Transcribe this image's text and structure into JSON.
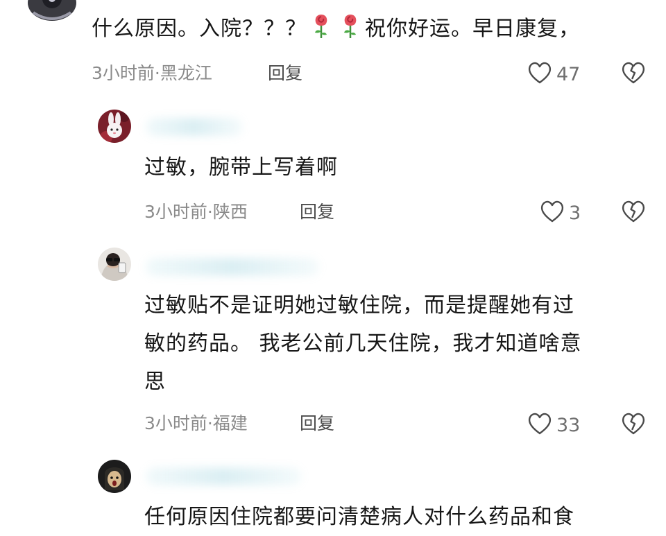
{
  "comments": [
    {
      "text_lines": [
        "什么原因。入院？？？"
      ],
      "text_after_emoji": "祝你好运。早日康复，",
      "emoji": [
        "rose-emoji",
        "rose-emoji"
      ],
      "time": "3小时前",
      "region": "黑龙江",
      "meta": "3小时前·黑龙江",
      "reply": "回复",
      "likes": "47"
    },
    {
      "text_lines": [
        "过敏，腕带上写着啊"
      ],
      "meta": "3小时前·陕西",
      "reply": "回复",
      "likes": "3"
    },
    {
      "text_lines": [
        "过敏贴不是证明她过敏住院，而是提醒她有过",
        "敏的药品。 我老公前几天住院，我才知道啥意",
        "思"
      ],
      "meta": "3小时前·福建",
      "reply": "回复",
      "likes": "33"
    },
    {
      "text_lines": [
        "任何原因住院都要问清楚病人对什么药品和食"
      ]
    }
  ],
  "colors": {
    "text": "#161616",
    "meta": "#8a8a8a",
    "icon": "#4a4a4a"
  },
  "icons": [
    "avatar",
    "heart-icon",
    "broken-heart-icon",
    "rose-emoji"
  ]
}
